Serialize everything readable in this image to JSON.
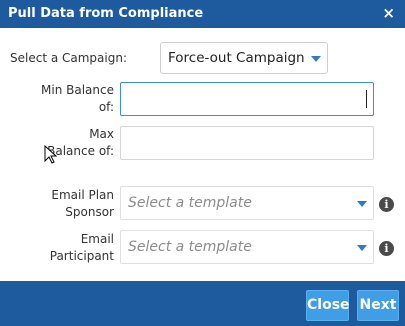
{
  "dialog": {
    "title": "Pull Data from Compliance",
    "close_glyph": "×"
  },
  "form": {
    "campaign_label": "Select a Campaign:",
    "campaign_value": "Force-out Campaign",
    "min_balance_label_line1": "Min Balance",
    "min_balance_label_line2": "of:",
    "min_balance_value": "",
    "max_balance_label_line1": "Max",
    "max_balance_label_line2": "Balance of:",
    "max_balance_value": "",
    "email_plan_sponsor_label_line1": "Email Plan",
    "email_plan_sponsor_label_line2": "Sponsor",
    "email_plan_sponsor_placeholder": "Select a template",
    "email_participant_label_line1": "Email",
    "email_participant_label_line2": "Participant",
    "email_participant_placeholder": "Select a template",
    "info_glyph": "i"
  },
  "footer": {
    "close_label": "Close",
    "next_label": "Next"
  },
  "colors": {
    "header_bg": "#1d5a9e",
    "button_bg": "#3f9ee6",
    "focus_border": "#3a8fd6",
    "caret": "#2e7cc7"
  },
  "icons": {
    "close": "close-icon",
    "dropdown": "chevron-down-icon",
    "info": "info-icon",
    "pointer": "mouse-pointer-icon"
  }
}
